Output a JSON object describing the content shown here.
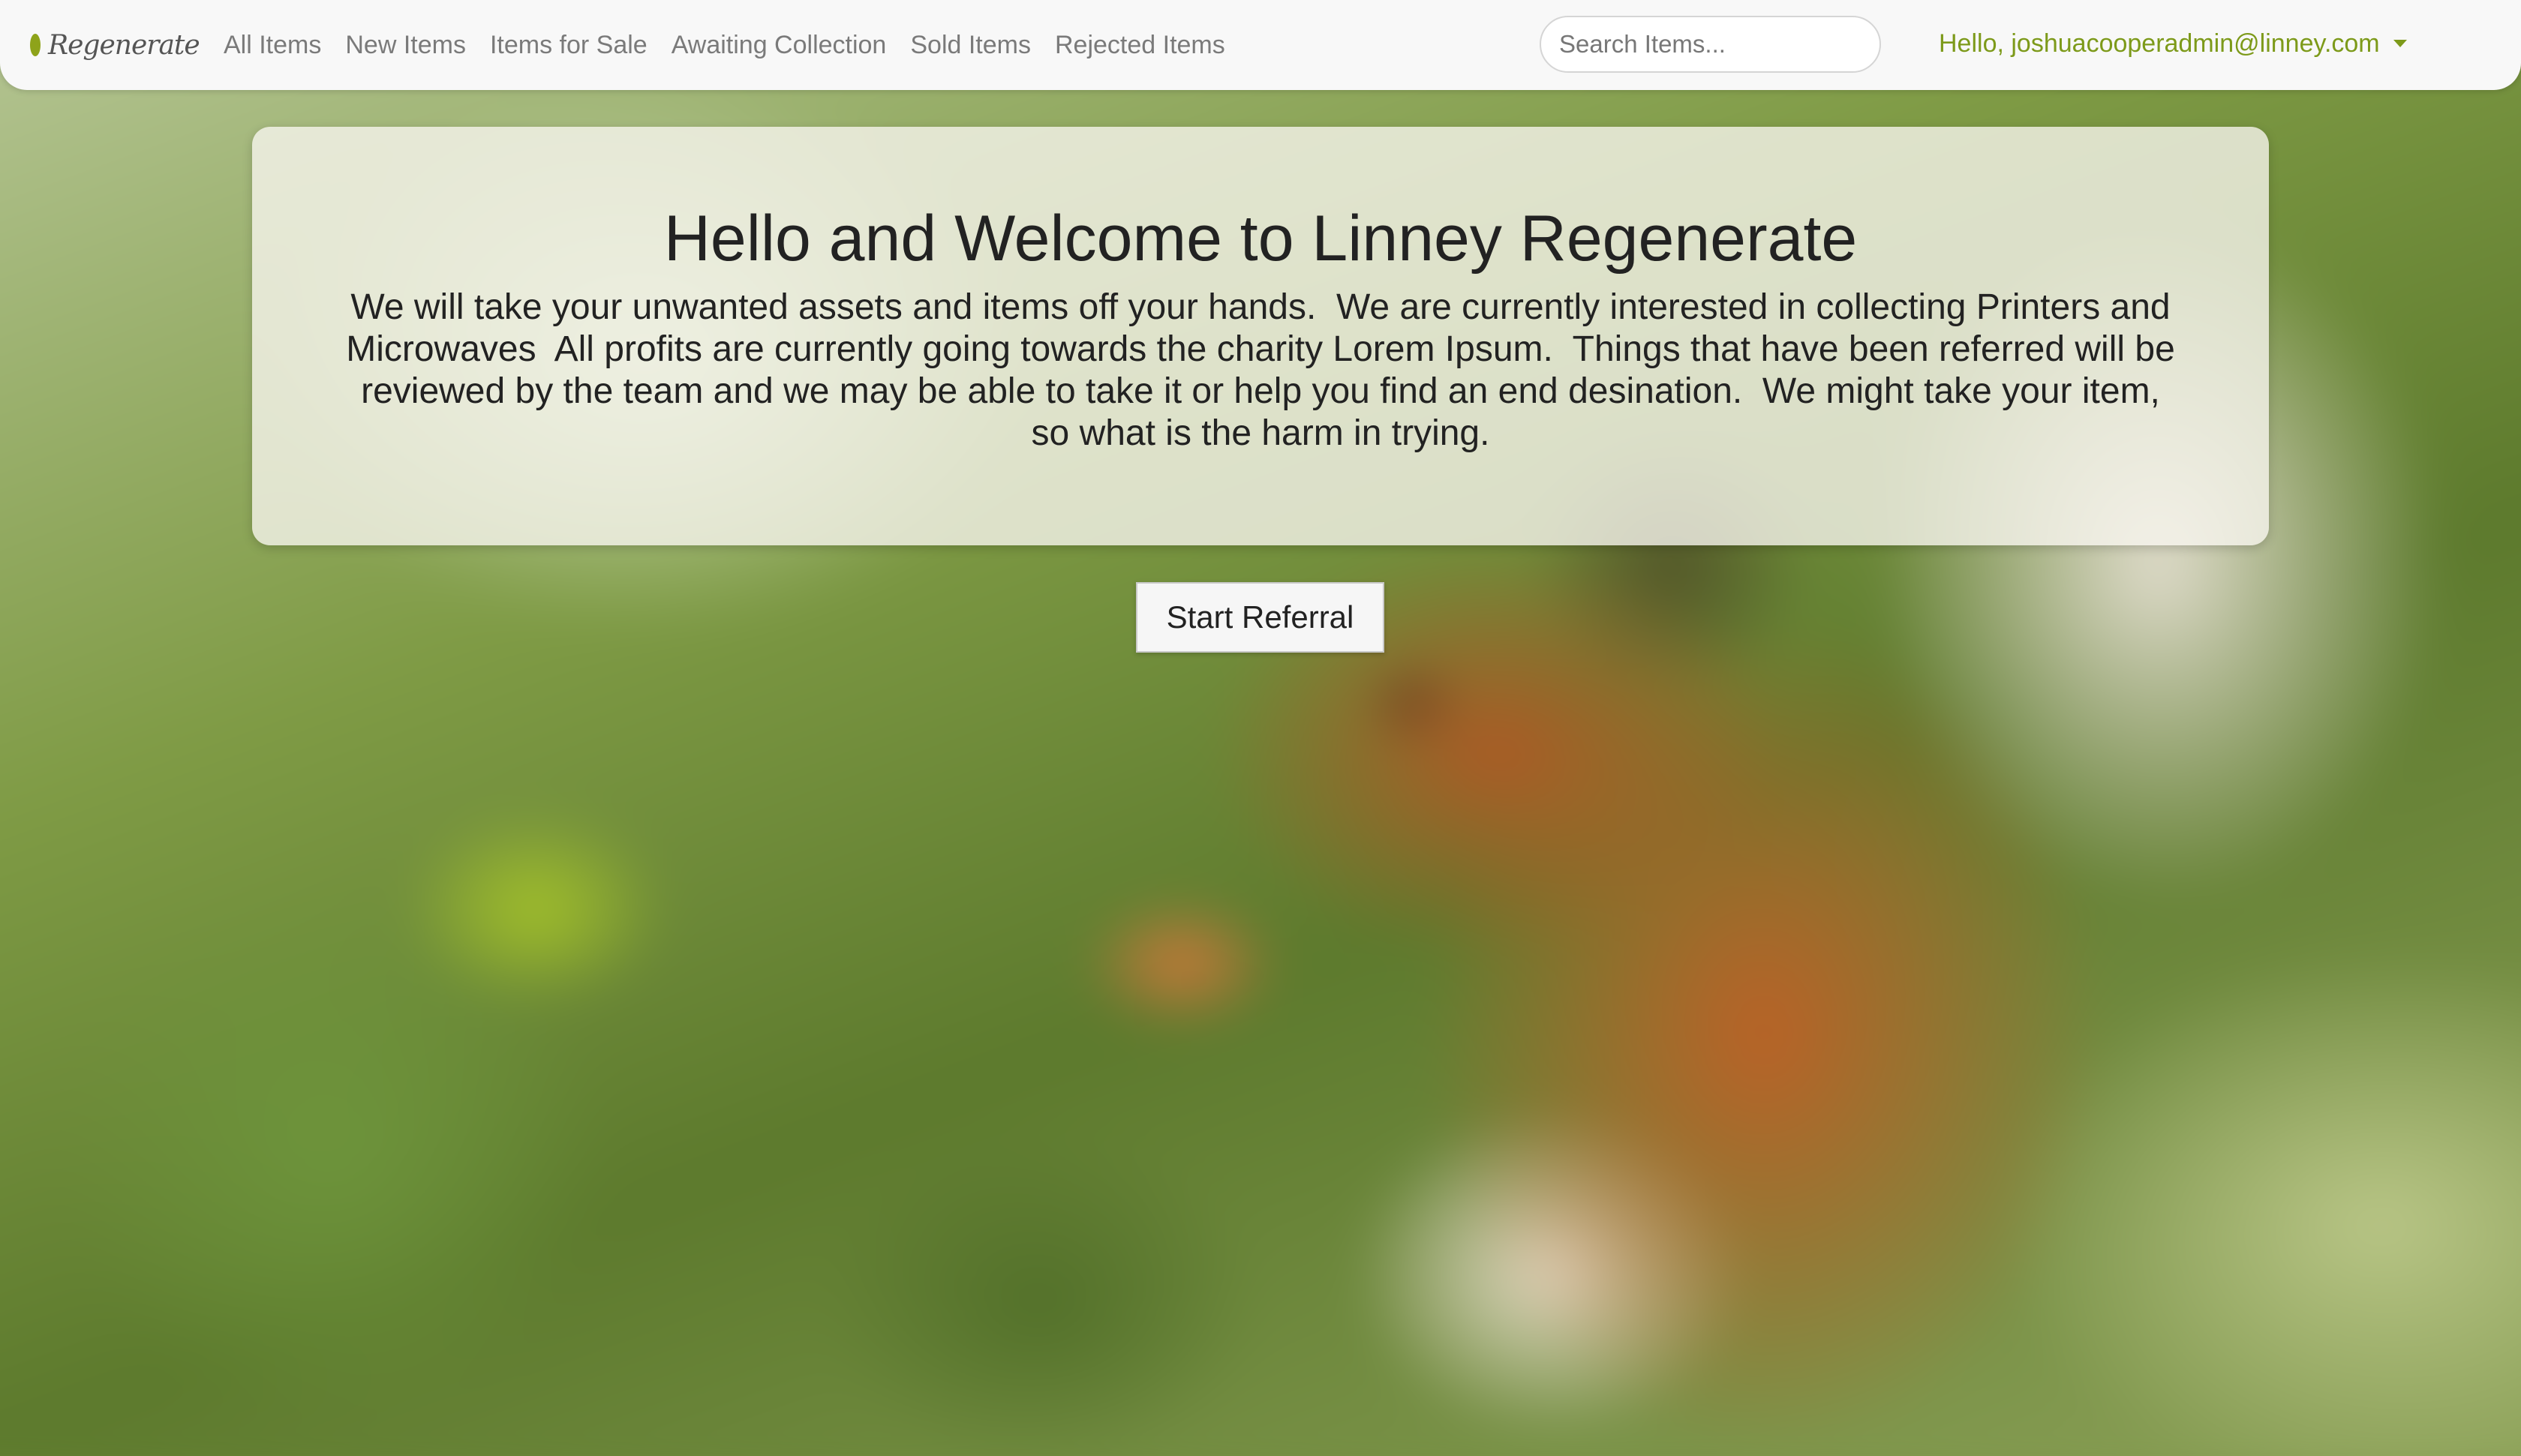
{
  "brand": {
    "logo_text": "Regenerate",
    "accent_color": "#8ea31a"
  },
  "nav": {
    "items": [
      {
        "label": "All Items"
      },
      {
        "label": "New Items"
      },
      {
        "label": "Items for Sale"
      },
      {
        "label": "Awaiting Collection"
      },
      {
        "label": "Sold Items"
      },
      {
        "label": "Rejected Items"
      }
    ]
  },
  "search": {
    "placeholder": "Search Items...",
    "value": ""
  },
  "user": {
    "greeting": "Hello, joshuacooperadmin@linney.com",
    "color": "#7d9a1a",
    "icon": "caret-down-icon"
  },
  "welcome": {
    "title": "Hello and Welcome to Linney Regenerate",
    "body": "We will take your unwanted assets and items off your hands.  We are currently interested in collecting Printers and Microwaves  All profits are currently going towards the charity Lorem Ipsum.  Things that have been referred will be reviewed by the team and we may be able to take it or help you find an end desination.  We might take your item, so what is the harm in trying."
  },
  "actions": {
    "start_referral_label": "Start Referral"
  }
}
